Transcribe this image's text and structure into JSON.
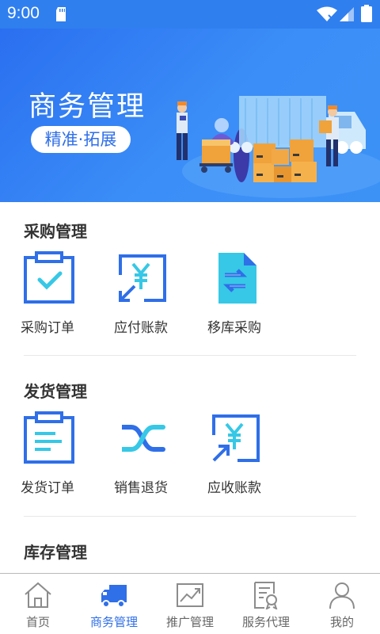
{
  "status_bar": {
    "time": "9:00"
  },
  "banner": {
    "title": "商务管理",
    "subtitle": "精准·拓展"
  },
  "sections": [
    {
      "title": "采购管理",
      "items": [
        {
          "label": "采购订单",
          "icon": "clipboard-check-icon"
        },
        {
          "label": "应付账款",
          "icon": "yen-outgoing-icon"
        },
        {
          "label": "移库采购",
          "icon": "file-transfer-icon"
        }
      ]
    },
    {
      "title": "发货管理",
      "items": [
        {
          "label": "发货订单",
          "icon": "clipboard-list-icon"
        },
        {
          "label": "销售退货",
          "icon": "crossing-arrows-icon"
        },
        {
          "label": "应收账款",
          "icon": "yen-incoming-icon"
        }
      ]
    },
    {
      "title": "库存管理",
      "items": []
    }
  ],
  "tab_bar": {
    "active": "商务管理",
    "tabs": [
      {
        "label": "首页",
        "icon": "home-icon"
      },
      {
        "label": "商务管理",
        "icon": "truck-icon"
      },
      {
        "label": "推广管理",
        "icon": "trend-chart-icon"
      },
      {
        "label": "服务代理",
        "icon": "certificate-icon"
      },
      {
        "label": "我的",
        "icon": "user-icon"
      }
    ]
  },
  "colors": {
    "primary": "#2f6fe8",
    "accent_cyan": "#36c8e6",
    "status_bar": "#2f7fef",
    "text": "#333333"
  }
}
